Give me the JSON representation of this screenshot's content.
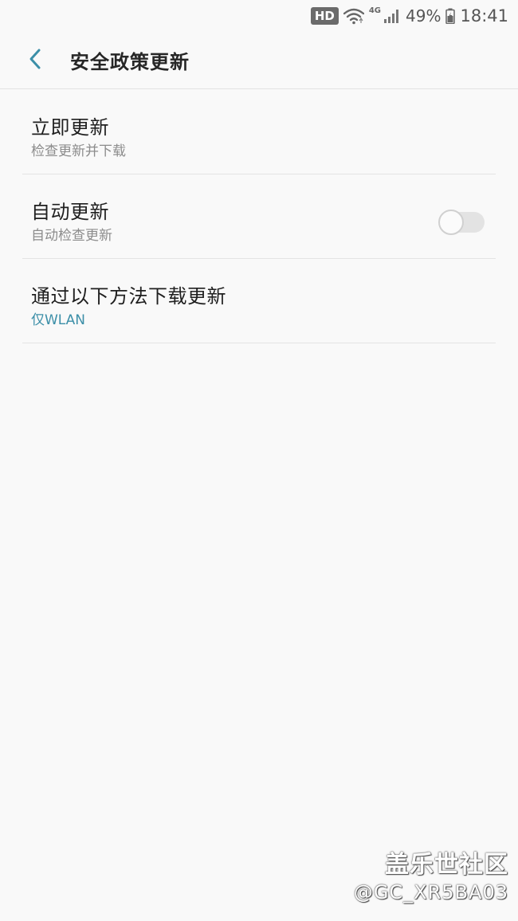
{
  "status_bar": {
    "hd_label": "HD",
    "network_label": "4G",
    "battery_percent": "49%",
    "time": "18:41"
  },
  "header": {
    "back_icon": "chevron-left-icon",
    "title": "安全政策更新"
  },
  "items": [
    {
      "title": "立即更新",
      "subtitle": "检查更新并下载"
    },
    {
      "title": "自动更新",
      "subtitle": "自动检查更新",
      "toggle_on": false
    },
    {
      "title": "通过以下方法下载更新",
      "subtitle": "仅WLAN"
    }
  ],
  "colors": {
    "accent": "#3c8fa8",
    "background": "#f9f9f9"
  },
  "watermark": {
    "line1": "盖乐世社区",
    "line2": "@GC_XR5BA03"
  }
}
